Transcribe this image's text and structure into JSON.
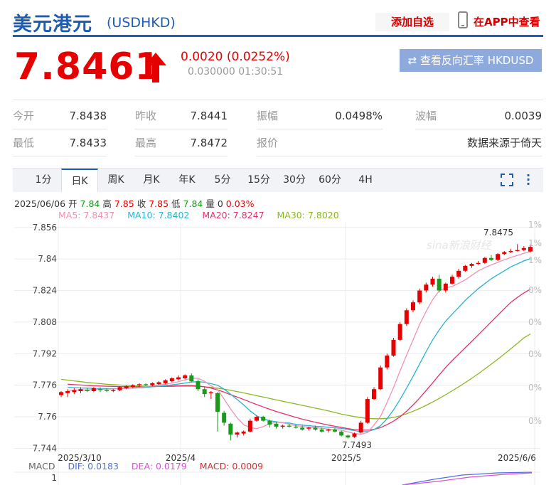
{
  "header": {
    "name": "美元港元",
    "code": "(USDHKD)",
    "add_watchlist": "添加自选",
    "view_in_app": "在APP中查看"
  },
  "quote": {
    "price": "7.8461",
    "change": "0.0020 (0.0252%)",
    "time": "0.030000 01:30:51",
    "reverse_button": "查看反向汇率 HKDUSD"
  },
  "stats": [
    {
      "label": "今开",
      "value": "7.8438"
    },
    {
      "label": "昨收",
      "value": "7.8441"
    },
    {
      "label": "振幅",
      "value": "0.0498%"
    },
    {
      "label": "波幅",
      "value": "0.0039"
    },
    {
      "label": "最低",
      "value": "7.8433"
    },
    {
      "label": "最高",
      "value": "7.8472"
    },
    {
      "label": "报价",
      "value": "数据来源于倚天"
    }
  ],
  "tabs": [
    {
      "label": "1分",
      "active": false
    },
    {
      "label": "日K",
      "active": true
    },
    {
      "label": "周K",
      "active": false
    },
    {
      "label": "月K",
      "active": false
    },
    {
      "label": "年K",
      "active": false
    },
    {
      "label": "5分",
      "active": false
    },
    {
      "label": "15分",
      "active": false
    },
    {
      "label": "30分",
      "active": false
    },
    {
      "label": "60分",
      "active": false
    },
    {
      "label": "4H",
      "active": false
    }
  ],
  "ohlc": {
    "date": "2025/06/06",
    "open_label": "开",
    "open": "7.84",
    "high_label": "高",
    "high": "7.85",
    "close_label": "收",
    "close": "7.85",
    "low_label": "低",
    "low": "7.84",
    "vol_label": "量",
    "vol": "0",
    "pct": "0.03%"
  },
  "ma_legend": [
    {
      "label": "MA5: 7.8437",
      "color": "#f191b4"
    },
    {
      "label": "MA10: 7.8402",
      "color": "#29b3d3"
    },
    {
      "label": "MA20: 7.8247",
      "color": "#e5306b"
    },
    {
      "label": "MA30: 7.8020",
      "color": "#8bb923"
    }
  ],
  "macd": {
    "title": "MACD",
    "dif": "DIF: 0.0183",
    "dea": "DEA: 0.0179",
    "macd": "MACD: 0.0009",
    "axis_label": "1"
  },
  "watermark": "sina新浪财经",
  "colors": {
    "up": "#e60000",
    "down": "#1a9a1a",
    "accent": "#1f5cb4"
  },
  "chart_data": {
    "type": "candlestick",
    "y_ticks": [
      "7.856",
      "7.84",
      "7.824",
      "7.808",
      "7.792",
      "7.776",
      "7.76",
      "7.744"
    ],
    "y_tick_values": [
      7.856,
      7.84,
      7.824,
      7.808,
      7.792,
      7.776,
      7.76,
      7.744
    ],
    "right_ticks": [
      "1%",
      "1%",
      "1%",
      "0%",
      "0%",
      "0%",
      "0%",
      "0%"
    ],
    "x_labels": [
      "2025/3/10",
      "2025/4",
      "2025/5",
      "2025/6/6"
    ],
    "max_label": "7.8475",
    "min_label": "7.7493",
    "ylim": [
      7.742,
      7.8588
    ],
    "ohlc": [
      [
        7.771,
        7.773,
        7.7725,
        7.77
      ],
      [
        7.772,
        7.774,
        7.773,
        7.77
      ],
      [
        7.7725,
        7.7745,
        7.7735,
        7.7715
      ],
      [
        7.773,
        7.775,
        7.774,
        7.772
      ],
      [
        7.7735,
        7.7745,
        7.773,
        7.7725
      ],
      [
        7.773,
        7.775,
        7.7745,
        7.7725
      ],
      [
        7.774,
        7.775,
        7.7735,
        7.7725
      ],
      [
        7.7735,
        7.7745,
        7.773,
        7.7725
      ],
      [
        7.773,
        7.774,
        7.7735,
        7.7725
      ],
      [
        7.7735,
        7.7755,
        7.775,
        7.773
      ],
      [
        7.7745,
        7.776,
        7.7755,
        7.774
      ],
      [
        7.775,
        7.7765,
        7.776,
        7.7745
      ],
      [
        7.776,
        7.777,
        7.7765,
        7.775
      ],
      [
        7.7765,
        7.777,
        7.776,
        7.7755
      ],
      [
        7.776,
        7.7775,
        7.777,
        7.7755
      ],
      [
        7.7765,
        7.778,
        7.7775,
        7.776
      ],
      [
        7.777,
        7.779,
        7.7785,
        7.7765
      ],
      [
        7.778,
        7.78,
        7.7795,
        7.7775
      ],
      [
        7.779,
        7.781,
        7.78,
        7.7785
      ],
      [
        7.7795,
        7.7815,
        7.781,
        7.779
      ],
      [
        7.781,
        7.782,
        7.778,
        7.7775
      ],
      [
        7.778,
        7.779,
        7.774,
        7.773
      ],
      [
        7.774,
        7.775,
        7.7715,
        7.77
      ],
      [
        7.772,
        7.773,
        7.7725,
        7.769
      ],
      [
        7.772,
        7.7725,
        7.7625,
        7.7525
      ],
      [
        7.762,
        7.763,
        7.757,
        7.7555
      ],
      [
        7.7565,
        7.757,
        7.751,
        7.748
      ],
      [
        7.751,
        7.7525,
        7.752,
        7.7495
      ],
      [
        7.7515,
        7.753,
        7.7525,
        7.7505
      ],
      [
        7.7525,
        7.759,
        7.758,
        7.752
      ],
      [
        7.758,
        7.7605,
        7.76,
        7.7575
      ],
      [
        7.76,
        7.7605,
        7.758,
        7.7575
      ],
      [
        7.758,
        7.7585,
        7.756,
        7.7545
      ],
      [
        7.7565,
        7.7575,
        7.755,
        7.754
      ],
      [
        7.755,
        7.756,
        7.7555,
        7.754
      ],
      [
        7.7555,
        7.7565,
        7.755,
        7.7545
      ],
      [
        7.755,
        7.756,
        7.7545,
        7.754
      ],
      [
        7.7545,
        7.7555,
        7.7535,
        7.753
      ],
      [
        7.754,
        7.755,
        7.7545,
        7.753
      ],
      [
        7.7545,
        7.7555,
        7.7535,
        7.753
      ],
      [
        7.7535,
        7.7545,
        7.7525,
        7.752
      ],
      [
        7.753,
        7.754,
        7.7535,
        7.752
      ],
      [
        7.7535,
        7.7545,
        7.7525,
        7.752
      ],
      [
        7.7525,
        7.753,
        7.7505,
        7.75
      ],
      [
        7.7505,
        7.751,
        7.7495,
        7.749
      ],
      [
        7.7498,
        7.752,
        7.7515,
        7.7493
      ],
      [
        7.752,
        7.758,
        7.757,
        7.7515
      ],
      [
        7.757,
        7.77,
        7.769,
        7.7565
      ],
      [
        7.769,
        7.775,
        7.774,
        7.7685
      ],
      [
        7.774,
        7.786,
        7.785,
        7.7735
      ],
      [
        7.785,
        7.792,
        7.791,
        7.784
      ],
      [
        7.791,
        7.8,
        7.799,
        7.7905
      ],
      [
        7.799,
        7.808,
        7.807,
        7.7985
      ],
      [
        7.807,
        7.815,
        7.814,
        7.806
      ],
      [
        7.814,
        7.819,
        7.818,
        7.813
      ],
      [
        7.818,
        7.825,
        7.824,
        7.817
      ],
      [
        7.824,
        7.828,
        7.827,
        7.823
      ],
      [
        7.827,
        7.831,
        7.83,
        7.826
      ],
      [
        7.83,
        7.832,
        7.824,
        7.823
      ],
      [
        7.824,
        7.828,
        7.8275,
        7.823
      ],
      [
        7.8275,
        7.832,
        7.831,
        7.827
      ],
      [
        7.831,
        7.835,
        7.834,
        7.83
      ],
      [
        7.834,
        7.837,
        7.8365,
        7.8335
      ],
      [
        7.8365,
        7.838,
        7.8375,
        7.8355
      ],
      [
        7.8375,
        7.839,
        7.838,
        7.837
      ],
      [
        7.838,
        7.841,
        7.8405,
        7.8375
      ],
      [
        7.8405,
        7.842,
        7.8395,
        7.839
      ],
      [
        7.8395,
        7.843,
        7.8425,
        7.839
      ],
      [
        7.8425,
        7.844,
        7.8435,
        7.842
      ],
      [
        7.8435,
        7.845,
        7.844,
        7.843
      ],
      [
        7.844,
        7.8475,
        7.8445,
        7.8438
      ],
      [
        7.8445,
        7.8465,
        7.8455,
        7.844
      ],
      [
        7.8438,
        7.8472,
        7.8461,
        7.8433
      ]
    ],
    "ma5": [
      7.7735,
      7.7735,
      7.7736,
      7.7737,
      7.7738,
      7.7739,
      7.774,
      7.7741,
      7.7742,
      7.7743,
      7.7746,
      7.7749,
      7.7753,
      7.7757,
      7.7761,
      7.7765,
      7.7771,
      7.7778,
      7.7787,
      7.7795,
      7.7795,
      7.778,
      7.7757,
      7.7738,
      7.769,
      7.764,
      7.7595,
      7.756,
      7.7545,
      7.754,
      7.755,
      7.7565,
      7.7572,
      7.757,
      7.7562,
      7.7555,
      7.7552,
      7.7547,
      7.7545,
      7.7542,
      7.7538,
      7.7535,
      7.7532,
      7.7524,
      7.7515,
      7.7512,
      7.752,
      7.7558,
      7.7602,
      7.7672,
      7.7748,
      7.7833,
      7.7912,
      7.799,
      7.8068,
      7.8134,
      7.8194,
      7.8238,
      7.8254,
      7.8261,
      7.8277,
      7.8294,
      7.8317,
      7.834,
      7.8356,
      7.837,
      7.8383,
      7.8396,
      7.8408,
      7.8418,
      7.8429,
      7.8437
    ],
    "ma10": [
      7.775,
      7.7748,
      7.7746,
      7.7745,
      7.7744,
      7.7743,
      7.7743,
      7.7743,
      7.7743,
      7.7744,
      7.7745,
      7.7747,
      7.7749,
      7.7752,
      7.7755,
      7.7758,
      7.7762,
      7.7766,
      7.7771,
      7.7776,
      7.7778,
      7.7775,
      7.7768,
      7.776,
      7.774,
      7.7715,
      7.7688,
      7.766,
      7.763,
      7.7605,
      7.759,
      7.758,
      7.7575,
      7.757,
      7.7568,
      7.7562,
      7.7558,
      7.7555,
      7.7552,
      7.755,
      7.7547,
      7.7544,
      7.7541,
      7.7536,
      7.753,
      7.7525,
      7.7525,
      7.7535,
      7.7555,
      7.759,
      7.7635,
      7.7688,
      7.7745,
      7.7805,
      7.7868,
      7.793,
      7.799,
      7.804,
      7.8085,
      7.812,
      7.8155,
      7.819,
      7.822,
      7.825,
      7.8275,
      7.83,
      7.832,
      7.834,
      7.836,
      7.8375,
      7.839,
      7.8402
    ],
    "ma20": [
      7.7765,
      7.7763,
      7.7761,
      7.7759,
      7.7757,
      7.7756,
      7.7755,
      7.7754,
      7.7753,
      7.7752,
      7.7752,
      7.7752,
      7.7752,
      7.7753,
      7.7754,
      7.7755,
      7.7756,
      7.7757,
      7.7758,
      7.7758,
      7.7756,
      7.7752,
      7.7745,
      7.7736,
      7.7725,
      7.7712,
      7.77,
      7.7688,
      7.7675,
      7.7662,
      7.765,
      7.7638,
      7.7627,
      7.7617,
      7.7607,
      7.7597,
      7.7588,
      7.758,
      7.7572,
      7.7565,
      7.7558,
      7.7552,
      7.7546,
      7.754,
      7.7535,
      7.7532,
      7.7532,
      7.7536,
      7.7545,
      7.756,
      7.7578,
      7.76,
      7.7628,
      7.766,
      7.7695,
      7.7733,
      7.7772,
      7.7812,
      7.785,
      7.7885,
      7.7918,
      7.795,
      7.7982,
      7.8015,
      7.8048,
      7.8082,
      7.8115,
      7.8148,
      7.818,
      7.8205,
      7.8228,
      7.8247
    ],
    "ma30": [
      7.779,
      7.7786,
      7.7782,
      7.7778,
      7.7774,
      7.7771,
      7.7768,
      7.7765,
      7.7763,
      7.7761,
      7.7759,
      7.7757,
      7.7756,
      7.7755,
      7.7754,
      7.7754,
      7.7754,
      7.7754,
      7.7755,
      7.7755,
      7.7755,
      7.7754,
      7.7752,
      7.7749,
      7.7745,
      7.774,
      7.7734,
      7.7728,
      7.7721,
      7.7714,
      7.7707,
      7.77,
      7.7693,
      7.7686,
      7.7679,
      7.7672,
      7.7665,
      7.7658,
      7.7651,
      7.7644,
      7.7637,
      7.763,
      7.7622,
      7.7614,
      7.7607,
      7.7601,
      7.7596,
      7.7592,
      7.759,
      7.759,
      7.7592,
      7.7597,
      7.7605,
      7.7615,
      7.7628,
      7.7642,
      7.7658,
      7.7675,
      7.7693,
      7.7712,
      7.7732,
      7.7752,
      7.7773,
      7.7795,
      7.7818,
      7.7842,
      7.7867,
      7.7892,
      7.7918,
      7.7945,
      7.7972,
      7.8,
      7.802
    ]
  }
}
